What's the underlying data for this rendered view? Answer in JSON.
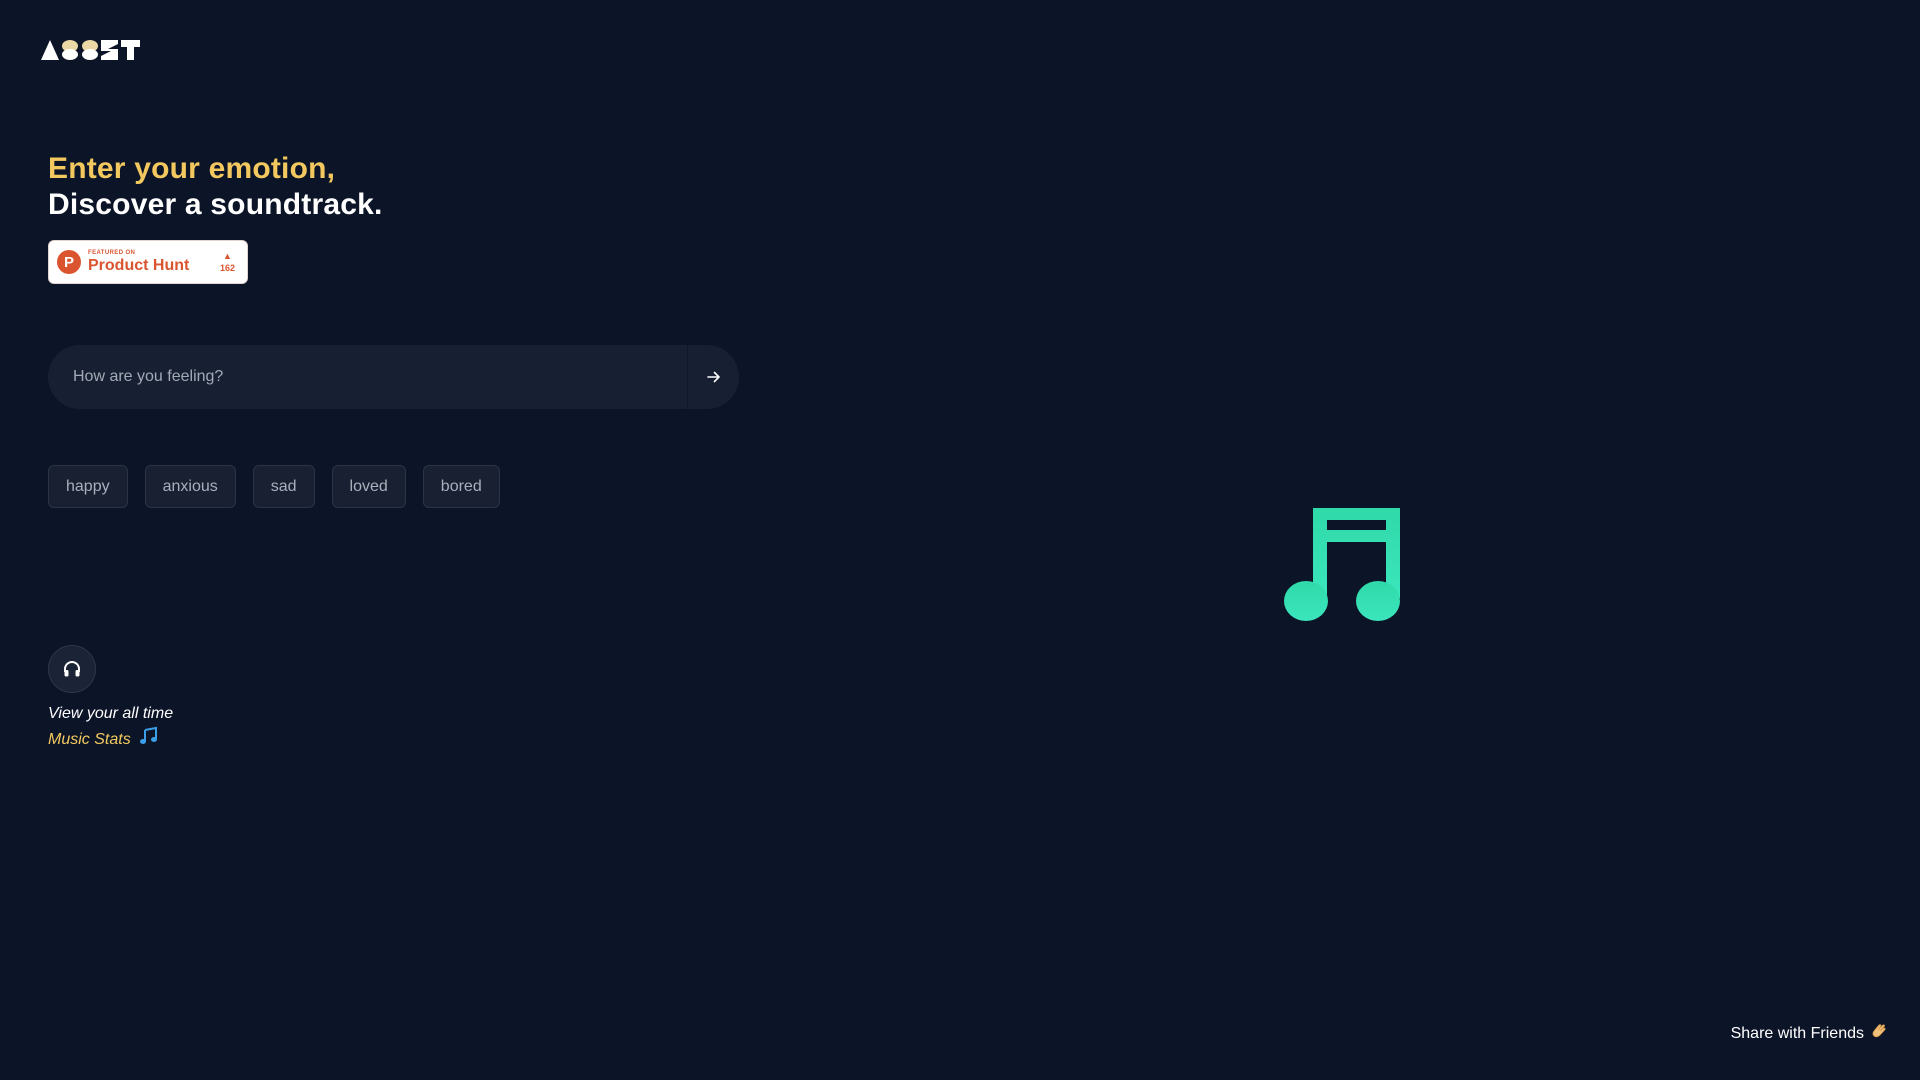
{
  "brand": {
    "logo_text": "ASSET"
  },
  "hero": {
    "line1": "Enter your emotion,",
    "line2": "Discover a soundtrack."
  },
  "product_hunt": {
    "small_label": "FEATURED ON",
    "name": "Product Hunt",
    "votes": "162",
    "logo_letter": "P"
  },
  "search": {
    "placeholder": "How are you feeling?",
    "value": ""
  },
  "emotions": [
    "happy",
    "anxious",
    "sad",
    "loved",
    "bored"
  ],
  "stats": {
    "line1": "View your all time",
    "line2": "Music Stats"
  },
  "footer": {
    "share_label": "Share with Friends"
  },
  "colors": {
    "background": "#0c1427",
    "accent_yellow": "#f3c95f",
    "note_green": "#2fe0b0",
    "product_hunt": "#da552f"
  },
  "icons": {
    "submit": "arrow-right-icon",
    "stats": "headphones-icon",
    "hero_graphic": "music-note-icon",
    "share": "clapping-hand-icon"
  }
}
